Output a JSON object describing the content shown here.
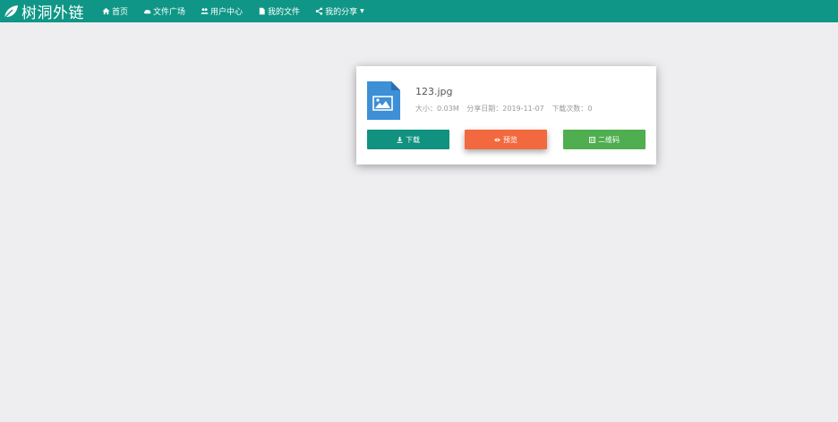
{
  "brand": {
    "title": "树洞外链"
  },
  "nav": {
    "items": [
      {
        "label": "首页",
        "icon": "home-icon"
      },
      {
        "label": "文件广场",
        "icon": "cloud-icon"
      },
      {
        "label": "用户中心",
        "icon": "users-icon"
      },
      {
        "label": "我的文件",
        "icon": "file-icon"
      },
      {
        "label": "我的分享",
        "icon": "share-icon"
      }
    ]
  },
  "file": {
    "name": "123.jpg",
    "size_label": "大小：",
    "size_value": "0.03M",
    "date_label": "分享日期：",
    "date_value": "2019-11-07",
    "downloads_label": "下载次数：",
    "downloads_value": "0"
  },
  "actions": {
    "download_label": "下载",
    "preview_label": "预览",
    "qrcode_label": "二维码"
  },
  "colors": {
    "navbar": "#0f9686",
    "download": "#11917f",
    "preview": "#f2693f",
    "qrcode": "#4fae4f",
    "file_icon": "#3d8fd6"
  }
}
